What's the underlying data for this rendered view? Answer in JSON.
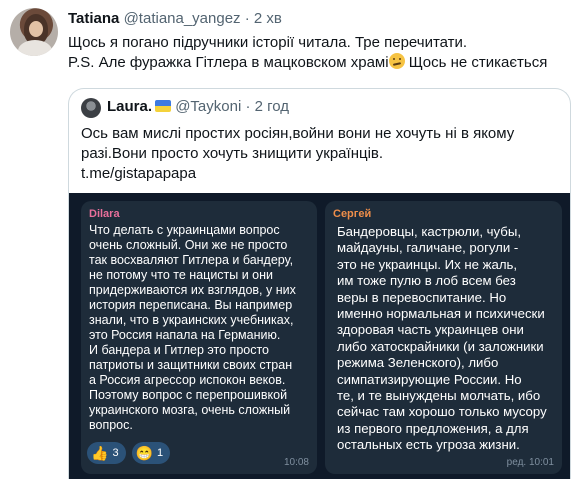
{
  "tweet": {
    "name": "Tatiana",
    "handle": "@tatiana_yangez",
    "dot": "·",
    "time": "2 хв",
    "lines": [
      "Щось я погано підручники історії читала. Тре перечитати.",
      "P.S. Але фуражка Гітлера в мацковском храмі",
      "Щось не стикається"
    ],
    "emoji_icon": "thinking-face-icon"
  },
  "quote": {
    "name": "Laura.",
    "flag_icon": "ukraine-flag-icon",
    "handle": "@Taykoni",
    "dot": "·",
    "time": "2 год",
    "lines": [
      "Ось вам  мислі простих росіян,войни вони не хочуть ні в якому",
      "разі.Вони просто хочуть знищити українців.",
      "t.me/gistapapapa"
    ]
  },
  "media": {
    "left": {
      "sender": "Dilara",
      "lines": [
        "Что делать с украинцами вопрос",
        "очень сложный. Они же не просто",
        "так восхваляют Гитлера и бандеру,",
        "не потому что те нацисты и они",
        "придерживаются их взглядов, у них",
        "история переписана. Вы например",
        "знали, что в украинских учебниках,",
        "это Россия напала на Германию.",
        "И бандера и Гитлер это просто",
        "патриоты и защитники своих стран",
        "а Россия агрессор испокон веков.",
        "Поэтому вопрос с перепрошивкой",
        "украинского мозга, очень сложный",
        "вопрос."
      ],
      "reactions": [
        {
          "icon": "👍",
          "count": "3"
        },
        {
          "icon": "😁",
          "count": "1"
        }
      ],
      "time": "10:08"
    },
    "right": {
      "sender": "Сергей",
      "lines": [
        "Бандеровцы, кастрюли, чубы,",
        "майдауны, галичане, рогули -",
        "это не украинцы. Их не жаль,",
        "им тоже пулю в лоб всем без",
        "веры в перевоспитание. Но",
        "именно нормальная и психически",
        "здоровая часть украинцев они",
        "либо хатоскрайники (и заложники",
        "режима Зеленского), либо",
        "симпатизирующие России. Но",
        "те, и те вынуждены молчать, ибо",
        "сейчас там хорошо только мусору",
        "из первого предложения, а для",
        "остальных есть угроза жизни."
      ],
      "time": "ред. 10:01"
    }
  },
  "colors": {
    "text": "#0f1419",
    "muted": "#536471",
    "border": "#cfd9de",
    "telegram_bg": "#0f1a29",
    "bubble_bg": "#1e2c3a"
  }
}
